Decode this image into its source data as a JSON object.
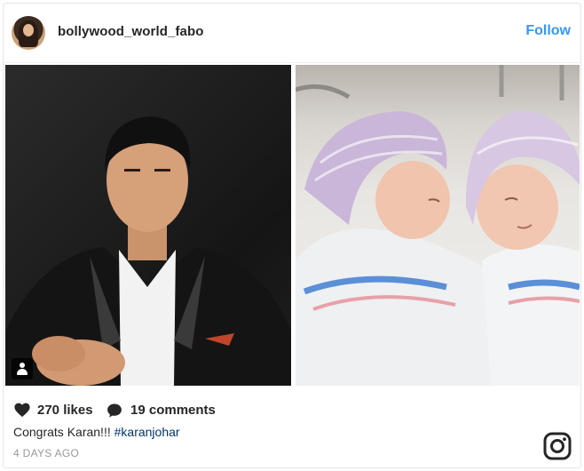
{
  "header": {
    "username": "bollywood_world_fabo",
    "follow_label": "Follow",
    "avatar_icon": "profile-photo"
  },
  "media": {
    "left_photo": "portrait-photo",
    "right_photo": "newborn-twins-photo",
    "tag_icon": "user-tag-icon"
  },
  "stats": {
    "likes": "270 likes",
    "comments": "19 comments",
    "like_icon": "heart-icon",
    "comment_icon": "comment-bubble-icon"
  },
  "caption": {
    "text": "Congrats Karan!!! ",
    "hashtag": "#karanjohar"
  },
  "timestamp": "4 DAYS AGO",
  "colors": {
    "follow": "#3897f0",
    "hashtag": "#003569",
    "timestamp": "#999999",
    "text": "#262626"
  }
}
